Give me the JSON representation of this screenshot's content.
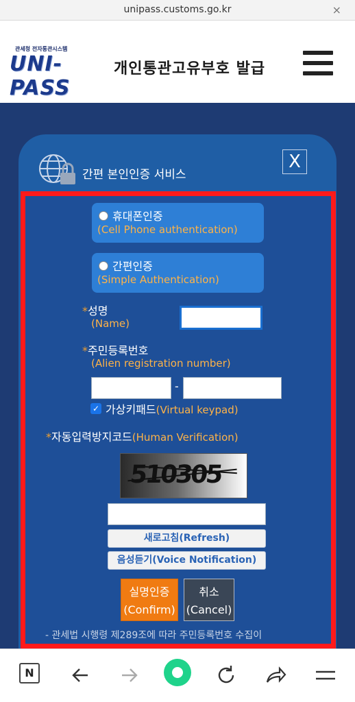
{
  "browser": {
    "url": "unipass.customs.go.kr",
    "close_glyph": "×"
  },
  "header": {
    "logo_small": "관세청 전자통관시스템",
    "logo_main": "UNI-PASS",
    "title": "개인통관고유부호 발급"
  },
  "modal": {
    "title": "간편 본인인증 서비스",
    "close_glyph": "X",
    "options": [
      {
        "ko": "휴대폰인증",
        "en": "(Cell Phone authentication)"
      },
      {
        "ko": "간편인증",
        "en": "(Simple Authentication)"
      }
    ],
    "name_label": "성명",
    "name_label_en": "(Name)",
    "reg_label": "주민등록번호",
    "reg_label_en": "(Alien registration number)",
    "reg_dash": "-",
    "vk_label_ko": "가상키패드",
    "vk_label_en": "(Virtual keypad)",
    "hv_label_ko": "자동입력방지코드",
    "hv_label_en": "(Human Verification)",
    "captcha_text": "510305",
    "refresh_label": "새로고침(Refresh)",
    "voice_label": "음성듣기(Voice Notification)",
    "confirm_ko": "실명인증",
    "confirm_en": "(Confirm)",
    "cancel_ko": "취소",
    "cancel_en": "(Cancel)",
    "notice": "- 관세법 시행령 제289조에 따라 주민등록번호 수집이",
    "required_mark": "*",
    "check_glyph": "✓"
  },
  "colors": {
    "modal_bg": "#1f5ea5",
    "page_bg": "#1e3b73",
    "highlight_border": "#ff1a1a",
    "confirm_bg": "#f07b12",
    "accent_text": "#ffb347"
  },
  "bottom_nav": [
    "n-icon",
    "back-arrow-icon",
    "forward-arrow-icon",
    "home-icon",
    "reload-icon",
    "share-icon",
    "menu-icon"
  ]
}
